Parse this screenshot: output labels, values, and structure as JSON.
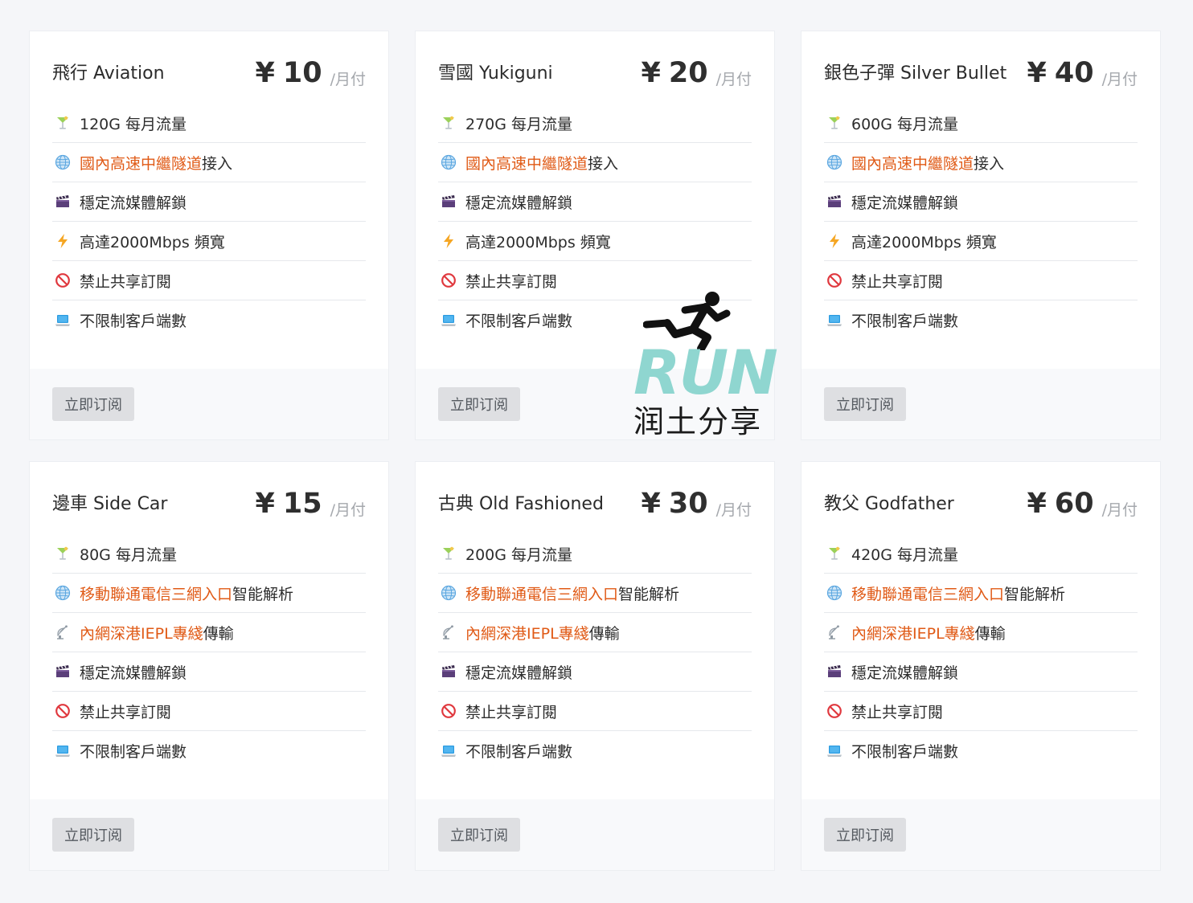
{
  "subscribe_label": "立即订阅",
  "watermark": {
    "text": "RUN",
    "subtext": "润土分享"
  },
  "colors": {
    "highlight": "#e05a16",
    "watermark": "#8fd6d0"
  },
  "plans": [
    {
      "name": "飛行 Aviation",
      "currency": "¥",
      "price": "10",
      "period": "/月付",
      "features": [
        {
          "icon": "cocktail-icon",
          "parts": [
            {
              "text": "120G 每月流量",
              "hl": false
            }
          ]
        },
        {
          "icon": "globe-icon",
          "parts": [
            {
              "text": "國內高速中繼隧道",
              "hl": true
            },
            {
              "text": "接入",
              "hl": false
            }
          ]
        },
        {
          "icon": "clapper-icon",
          "parts": [
            {
              "text": "穩定流媒體解鎖",
              "hl": false
            }
          ]
        },
        {
          "icon": "lightning-icon",
          "parts": [
            {
              "text": "高達2000Mbps 頻寬",
              "hl": false
            }
          ]
        },
        {
          "icon": "no-entry-icon",
          "parts": [
            {
              "text": "禁止共享訂閱",
              "hl": false
            }
          ]
        },
        {
          "icon": "laptop-icon",
          "parts": [
            {
              "text": "不限制客戶端數",
              "hl": false
            }
          ]
        }
      ]
    },
    {
      "name": "雪國 Yukiguni",
      "currency": "¥",
      "price": "20",
      "period": "/月付",
      "features": [
        {
          "icon": "cocktail-icon",
          "parts": [
            {
              "text": "270G 每月流量",
              "hl": false
            }
          ]
        },
        {
          "icon": "globe-icon",
          "parts": [
            {
              "text": "國內高速中繼隧道",
              "hl": true
            },
            {
              "text": "接入",
              "hl": false
            }
          ]
        },
        {
          "icon": "clapper-icon",
          "parts": [
            {
              "text": "穩定流媒體解鎖",
              "hl": false
            }
          ]
        },
        {
          "icon": "lightning-icon",
          "parts": [
            {
              "text": "高達2000Mbps 頻寬",
              "hl": false
            }
          ]
        },
        {
          "icon": "no-entry-icon",
          "parts": [
            {
              "text": "禁止共享訂閱",
              "hl": false
            }
          ]
        },
        {
          "icon": "laptop-icon",
          "parts": [
            {
              "text": "不限制客戶端數",
              "hl": false
            }
          ]
        }
      ]
    },
    {
      "name": "銀色子彈 Silver Bullet",
      "currency": "¥",
      "price": "40",
      "period": "/月付",
      "features": [
        {
          "icon": "cocktail-icon",
          "parts": [
            {
              "text": "600G 每月流量",
              "hl": false
            }
          ]
        },
        {
          "icon": "globe-icon",
          "parts": [
            {
              "text": "國內高速中繼隧道",
              "hl": true
            },
            {
              "text": "接入",
              "hl": false
            }
          ]
        },
        {
          "icon": "clapper-icon",
          "parts": [
            {
              "text": "穩定流媒體解鎖",
              "hl": false
            }
          ]
        },
        {
          "icon": "lightning-icon",
          "parts": [
            {
              "text": "高達2000Mbps 頻寬",
              "hl": false
            }
          ]
        },
        {
          "icon": "no-entry-icon",
          "parts": [
            {
              "text": "禁止共享訂閱",
              "hl": false
            }
          ]
        },
        {
          "icon": "laptop-icon",
          "parts": [
            {
              "text": "不限制客戶端數",
              "hl": false
            }
          ]
        }
      ]
    },
    {
      "name": "邊車 Side Car",
      "currency": "¥",
      "price": "15",
      "period": "/月付",
      "features": [
        {
          "icon": "cocktail-icon",
          "parts": [
            {
              "text": "80G 每月流量",
              "hl": false
            }
          ]
        },
        {
          "icon": "globe-icon",
          "parts": [
            {
              "text": "移動聯通電信三網入口",
              "hl": true
            },
            {
              "text": "智能解析",
              "hl": false
            }
          ]
        },
        {
          "icon": "satellite-icon",
          "parts": [
            {
              "text": "內網深港IEPL專綫",
              "hl": true
            },
            {
              "text": "傳輸",
              "hl": false
            }
          ]
        },
        {
          "icon": "clapper-icon",
          "parts": [
            {
              "text": "穩定流媒體解鎖",
              "hl": false
            }
          ]
        },
        {
          "icon": "no-entry-icon",
          "parts": [
            {
              "text": "禁止共享訂閱",
              "hl": false
            }
          ]
        },
        {
          "icon": "laptop-icon",
          "parts": [
            {
              "text": "不限制客戶端數",
              "hl": false
            }
          ]
        }
      ]
    },
    {
      "name": "古典 Old Fashioned",
      "currency": "¥",
      "price": "30",
      "period": "/月付",
      "features": [
        {
          "icon": "cocktail-icon",
          "parts": [
            {
              "text": "200G 每月流量",
              "hl": false
            }
          ]
        },
        {
          "icon": "globe-icon",
          "parts": [
            {
              "text": "移動聯通電信三網入口",
              "hl": true
            },
            {
              "text": "智能解析",
              "hl": false
            }
          ]
        },
        {
          "icon": "satellite-icon",
          "parts": [
            {
              "text": "內網深港IEPL專綫",
              "hl": true
            },
            {
              "text": "傳輸",
              "hl": false
            }
          ]
        },
        {
          "icon": "clapper-icon",
          "parts": [
            {
              "text": "穩定流媒體解鎖",
              "hl": false
            }
          ]
        },
        {
          "icon": "no-entry-icon",
          "parts": [
            {
              "text": "禁止共享訂閱",
              "hl": false
            }
          ]
        },
        {
          "icon": "laptop-icon",
          "parts": [
            {
              "text": "不限制客戶端數",
              "hl": false
            }
          ]
        }
      ]
    },
    {
      "name": "教父 Godfather",
      "currency": "¥",
      "price": "60",
      "period": "/月付",
      "features": [
        {
          "icon": "cocktail-icon",
          "parts": [
            {
              "text": "420G 每月流量",
              "hl": false
            }
          ]
        },
        {
          "icon": "globe-icon",
          "parts": [
            {
              "text": "移動聯通電信三網入口",
              "hl": true
            },
            {
              "text": "智能解析",
              "hl": false
            }
          ]
        },
        {
          "icon": "satellite-icon",
          "parts": [
            {
              "text": "內網深港IEPL專綫",
              "hl": true
            },
            {
              "text": "傳輸",
              "hl": false
            }
          ]
        },
        {
          "icon": "clapper-icon",
          "parts": [
            {
              "text": "穩定流媒體解鎖",
              "hl": false
            }
          ]
        },
        {
          "icon": "no-entry-icon",
          "parts": [
            {
              "text": "禁止共享訂閱",
              "hl": false
            }
          ]
        },
        {
          "icon": "laptop-icon",
          "parts": [
            {
              "text": "不限制客戶端數",
              "hl": false
            }
          ]
        }
      ]
    }
  ]
}
